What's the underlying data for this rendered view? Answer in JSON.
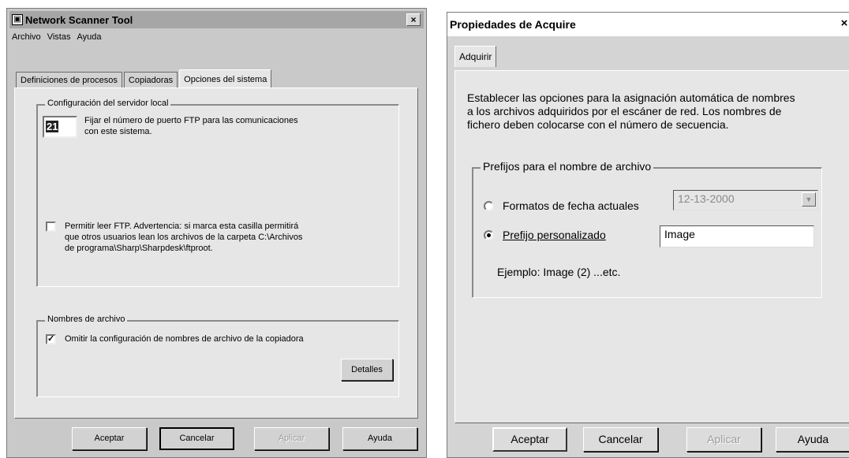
{
  "left_window": {
    "title": "Network Scanner Tool",
    "close_label": "×",
    "menu": [
      "Archivo",
      "Vistas",
      "Ayuda"
    ],
    "tabs": [
      "Definiciones de procesos",
      "Copiadoras",
      "Opciones del sistema"
    ],
    "active_tab": "Opciones del sistema",
    "server_group": {
      "legend": "Configuración del servidor local",
      "port_value": "21",
      "port_desc_1": "Fijar el número de puerto FTP para las comunicaciones",
      "port_desc_2": "con este sistema.",
      "ftp_line_1": "Permitir leer FTP. Advertencia: si marca esta casilla permitirá",
      "ftp_line_2": "que otros usuarios lean los archivos de la carpeta C:\\Archivos",
      "ftp_line_3": "de programa\\Sharp\\Sharpdesk\\ftproot.",
      "ftp_checked": false
    },
    "filenames_group": {
      "legend": "Nombres de archivo",
      "omit_label": "Omitir la configuración de nombres de archivo de la copiadora",
      "omit_checked": true,
      "details_button": "Detalles"
    },
    "buttons": {
      "ok": "Aceptar",
      "cancel": "Cancelar",
      "apply": "Aplicar",
      "help": "Ayuda"
    }
  },
  "right_window": {
    "title": "Propiedades de Acquire",
    "close_label": "×",
    "tab": "Adquirir",
    "description_1": "Establecer las opciones para la asignación automática de nombres",
    "description_2": "a los archivos adquiridos por el escáner de red. Los nombres de",
    "description_3": "fichero deben colocarse con el número de secuencia.",
    "prefix_group": {
      "legend": "Prefijos para el nombre de archivo",
      "date_option": "Formatos de fecha actuales",
      "date_value": "12-13-2000",
      "custom_option": "Prefijo personalizado",
      "custom_value": "Image",
      "selected": "custom",
      "example": "Ejemplo: Image (2) ...etc."
    },
    "buttons": {
      "ok": "Aceptar",
      "cancel": "Cancelar",
      "apply": "Aplicar",
      "help": "Ayuda"
    }
  }
}
